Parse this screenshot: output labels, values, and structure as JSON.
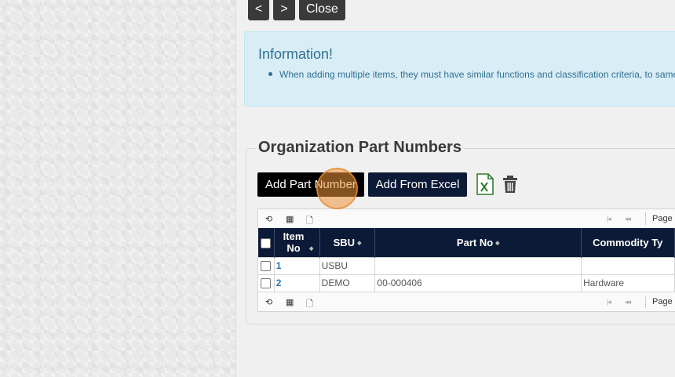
{
  "nav": {
    "prev_label": "<",
    "next_label": ">",
    "close_label": "Close"
  },
  "info": {
    "title": "Information!",
    "items": [
      "When adding multiple items, they must have similar functions and classification criteria, to same"
    ]
  },
  "section": {
    "title": "Organization Part Numbers",
    "add_part_label": "Add Part Number",
    "add_excel_label": "Add From Excel",
    "excel_icon": "excel-icon",
    "delete_icon": "trash-icon"
  },
  "pager": {
    "icons": [
      "refresh-icon",
      "table-icon",
      "document-icon"
    ],
    "page_label": "Page"
  },
  "grid": {
    "columns": [
      "Item No",
      "SBU",
      "Part No",
      "Commodity Ty"
    ],
    "rows": [
      {
        "item_no": "1",
        "sbu": "USBU",
        "part_no": "",
        "commodity": ""
      },
      {
        "item_no": "2",
        "sbu": "DEMO",
        "part_no": "00-000406",
        "commodity": "Hardware"
      }
    ]
  },
  "colors": {
    "header_bg": "#0b1a36",
    "button_dark": "#000000",
    "info_bg": "#d9edf7",
    "info_text": "#31708f",
    "excel_green": "#2e7d32"
  }
}
